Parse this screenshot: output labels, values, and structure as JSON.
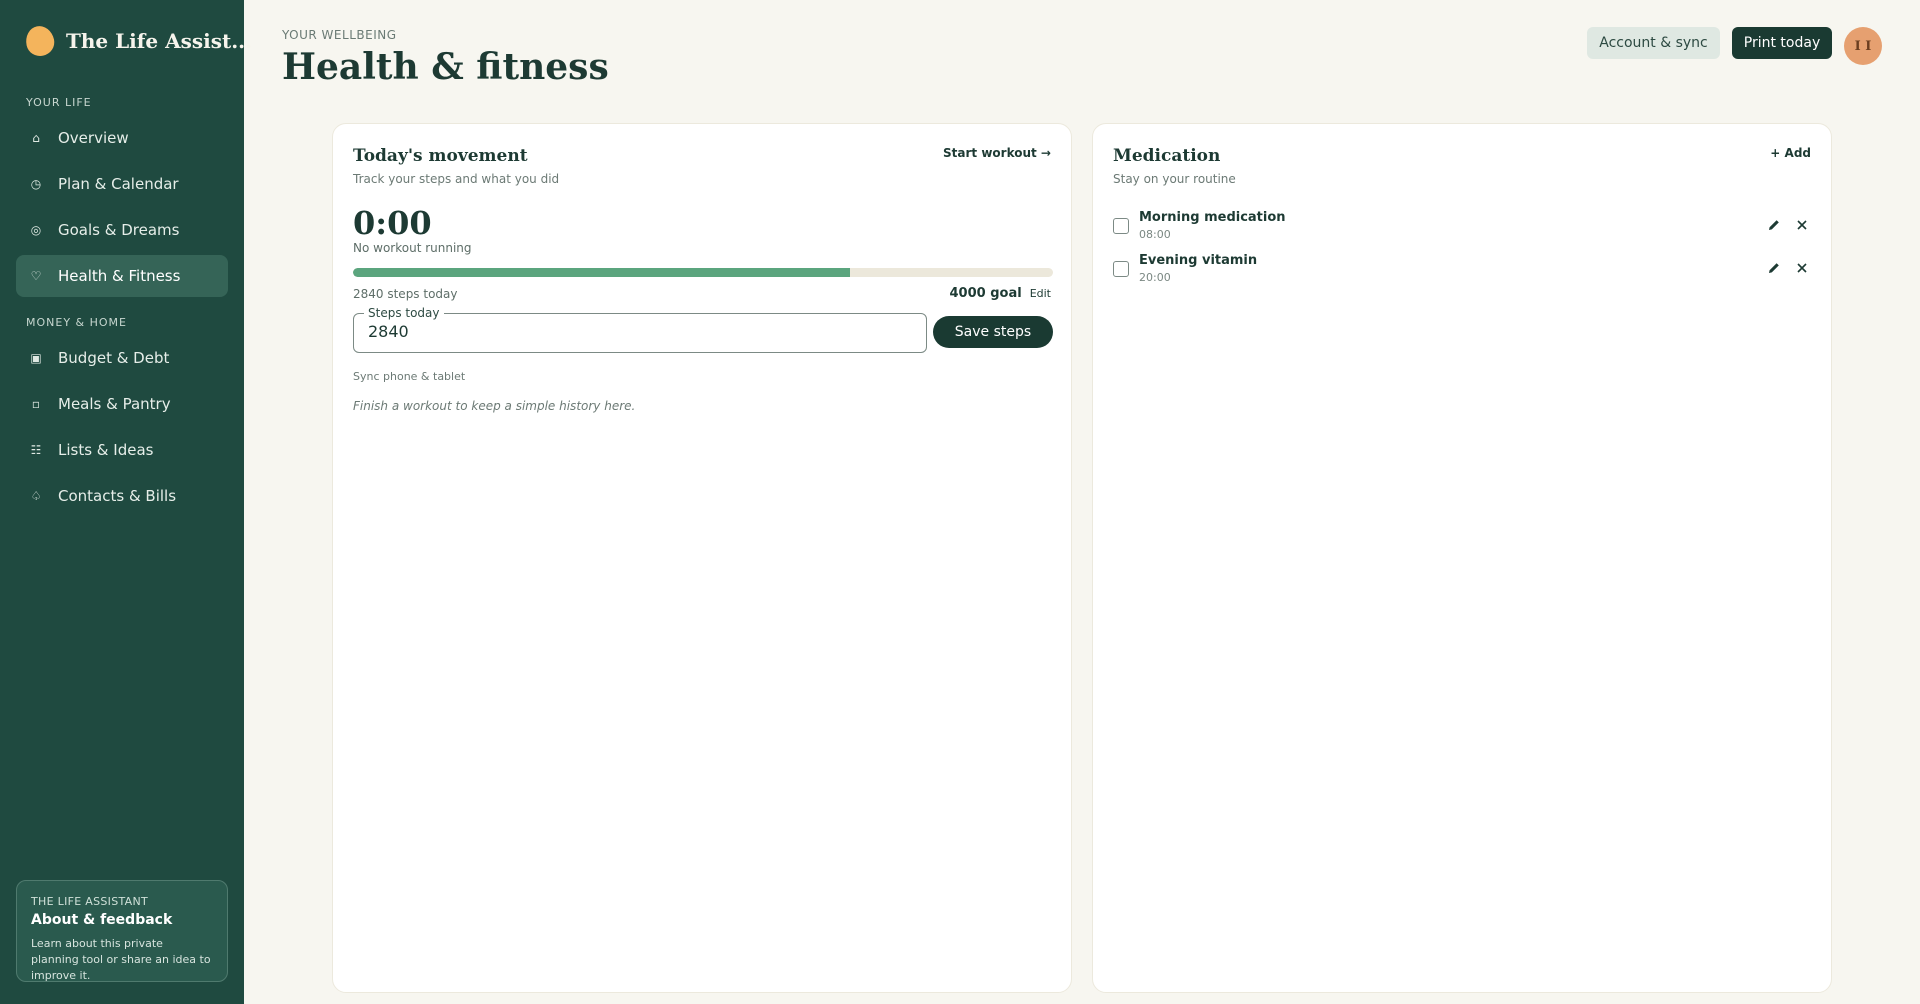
{
  "app": {
    "name": "The Life Assist..."
  },
  "sidebar": {
    "sections": [
      {
        "label": "YOUR LIFE"
      },
      {
        "label": "MONEY & HOME"
      }
    ],
    "items": [
      {
        "label": "Overview",
        "icon": "home-icon",
        "glyph": "⌂",
        "active": false
      },
      {
        "label": "Plan & Calendar",
        "icon": "clock-icon",
        "glyph": "◷",
        "active": false
      },
      {
        "label": "Goals & Dreams",
        "icon": "target-icon",
        "glyph": "◎",
        "active": false
      },
      {
        "label": "Health & Fitness",
        "icon": "heart-icon",
        "glyph": "♡",
        "active": true
      },
      {
        "label": "Budget & Debt",
        "icon": "wallet-icon",
        "glyph": "▣",
        "active": false
      },
      {
        "label": "Meals & Pantry",
        "icon": "bowl-icon",
        "glyph": "▫",
        "active": false
      },
      {
        "label": "Lists & Ideas",
        "icon": "list-icon",
        "glyph": "☷",
        "active": false
      },
      {
        "label": "Contacts & Bills",
        "icon": "bell-icon",
        "glyph": "♤",
        "active": false
      }
    ],
    "about": {
      "kicker": "THE LIFE ASSISTANT",
      "title": "About & feedback",
      "text": "Learn about this private planning tool or share an idea to improve it."
    }
  },
  "header": {
    "kicker": "YOUR WELLBEING",
    "title": "Health & fitness",
    "account_label": "Account & sync",
    "print_label": "Print today",
    "avatar_initials": "I I"
  },
  "movement": {
    "title": "Today's movement",
    "subtitle": "Track your steps and what you did",
    "start_label": "Start workout →",
    "timer": "0:00",
    "status": "No workout running",
    "steps_label": "2840 steps today",
    "goal_label": "4000 goal",
    "edit_label": "Edit",
    "progress_fraction": 0.71,
    "input_legend": "Steps today",
    "input_value": "2840",
    "save_label": "Save steps",
    "sync_label": "Sync phone & tablet",
    "history_empty": "Finish a workout to keep a simple history here."
  },
  "medication": {
    "title": "Medication",
    "subtitle": "Stay on your routine",
    "add_label": "+ Add",
    "items": [
      {
        "name": "Morning medication",
        "time": "08:00"
      },
      {
        "name": "Evening vitamin",
        "time": "20:00"
      }
    ]
  },
  "colors": {
    "sidebar": "#1f4a40",
    "accent": "#5ba57e",
    "brand": "#f4b45c",
    "dark_button": "#1a3a32"
  }
}
